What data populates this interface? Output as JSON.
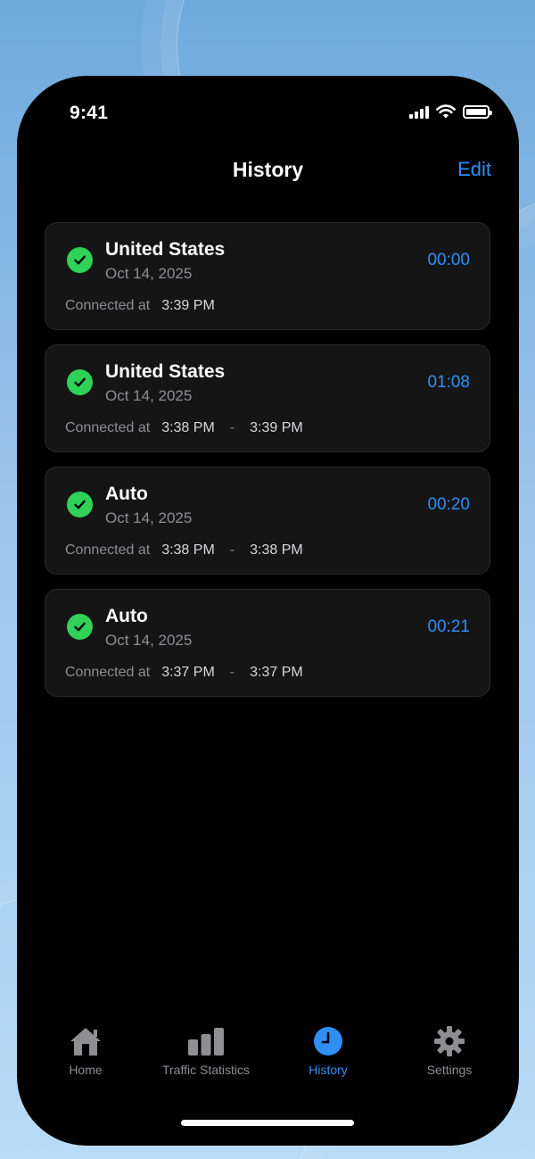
{
  "status_bar": {
    "time": "9:41"
  },
  "nav": {
    "title": "History",
    "edit_label": "Edit"
  },
  "history": [
    {
      "title": "United States",
      "date": "Oct 14, 2025",
      "duration": "00:00",
      "connected_label": "Connected at",
      "start": "3:39 PM",
      "end": ""
    },
    {
      "title": "United States",
      "date": "Oct 14, 2025",
      "duration": "01:08",
      "connected_label": "Connected at",
      "start": "3:38 PM",
      "separator": "-",
      "end": "3:39 PM"
    },
    {
      "title": "Auto",
      "date": "Oct 14, 2025",
      "duration": "00:20",
      "connected_label": "Connected at",
      "start": "3:38 PM",
      "separator": "-",
      "end": "3:38 PM"
    },
    {
      "title": "Auto",
      "date": "Oct 14, 2025",
      "duration": "00:21",
      "connected_label": "Connected at",
      "start": "3:37 PM",
      "separator": "-",
      "end": "3:37 PM"
    }
  ],
  "tabs": [
    {
      "label": "Home",
      "icon": "home-icon"
    },
    {
      "label": "Traffic Statistics",
      "icon": "bar-chart-icon"
    },
    {
      "label": "History",
      "icon": "clock-icon",
      "active": true
    },
    {
      "label": "Settings",
      "icon": "gear-icon"
    }
  ],
  "colors": {
    "accent": "#2f8ff5",
    "success": "#2fd158",
    "card_bg": "#151515"
  }
}
